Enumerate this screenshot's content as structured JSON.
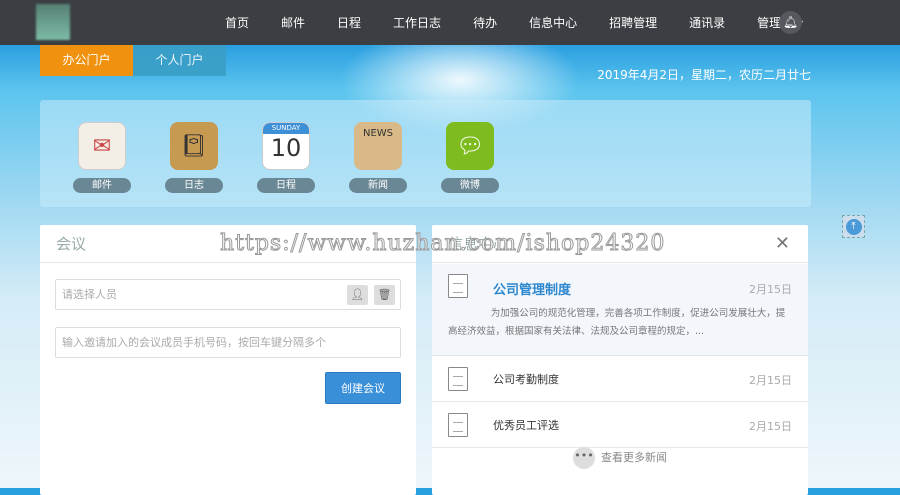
{
  "nav": {
    "items": [
      "首页",
      "邮件",
      "日程",
      "工作日志",
      "待办",
      "信息中心",
      "招聘管理",
      "通讯录"
    ],
    "user": "管理员"
  },
  "tabs": [
    "办公门户",
    "个人门户"
  ],
  "date": "2019年4月2日，星期二，农历二月廿七",
  "apps": [
    {
      "label": "邮件",
      "color": "#e9e3d8"
    },
    {
      "label": "日志",
      "color": "#c79a52"
    },
    {
      "label": "日程",
      "color": "#3d8fd6",
      "day": "SUNDAY",
      "num": "10"
    },
    {
      "label": "新闻",
      "color": "#d8b987",
      "word": "NEWS"
    },
    {
      "label": "微博",
      "color": "#7dbb1f"
    }
  ],
  "meeting": {
    "title": "会议",
    "person_placeholder": "请选择人员",
    "phone_placeholder": "输入邀请加入的会议成员手机号码，按回车键分隔多个",
    "create": "创建会议"
  },
  "news": {
    "title": "信息中心",
    "featured": {
      "title": "公司管理制度",
      "date": "2月15日",
      "summary": "为加强公司的规范化管理，完善各项工作制度，促进公司发展壮大，提高经济效益，根据国家有关法律、法规及公司章程的规定，..."
    },
    "items": [
      {
        "title": "公司考勤制度",
        "date": "2月15日"
      },
      {
        "title": "优秀员工评选",
        "date": "2月15日"
      }
    ],
    "more": "查看更多新闻"
  },
  "watermark": "https://www.huzhan.com/ishop24320"
}
